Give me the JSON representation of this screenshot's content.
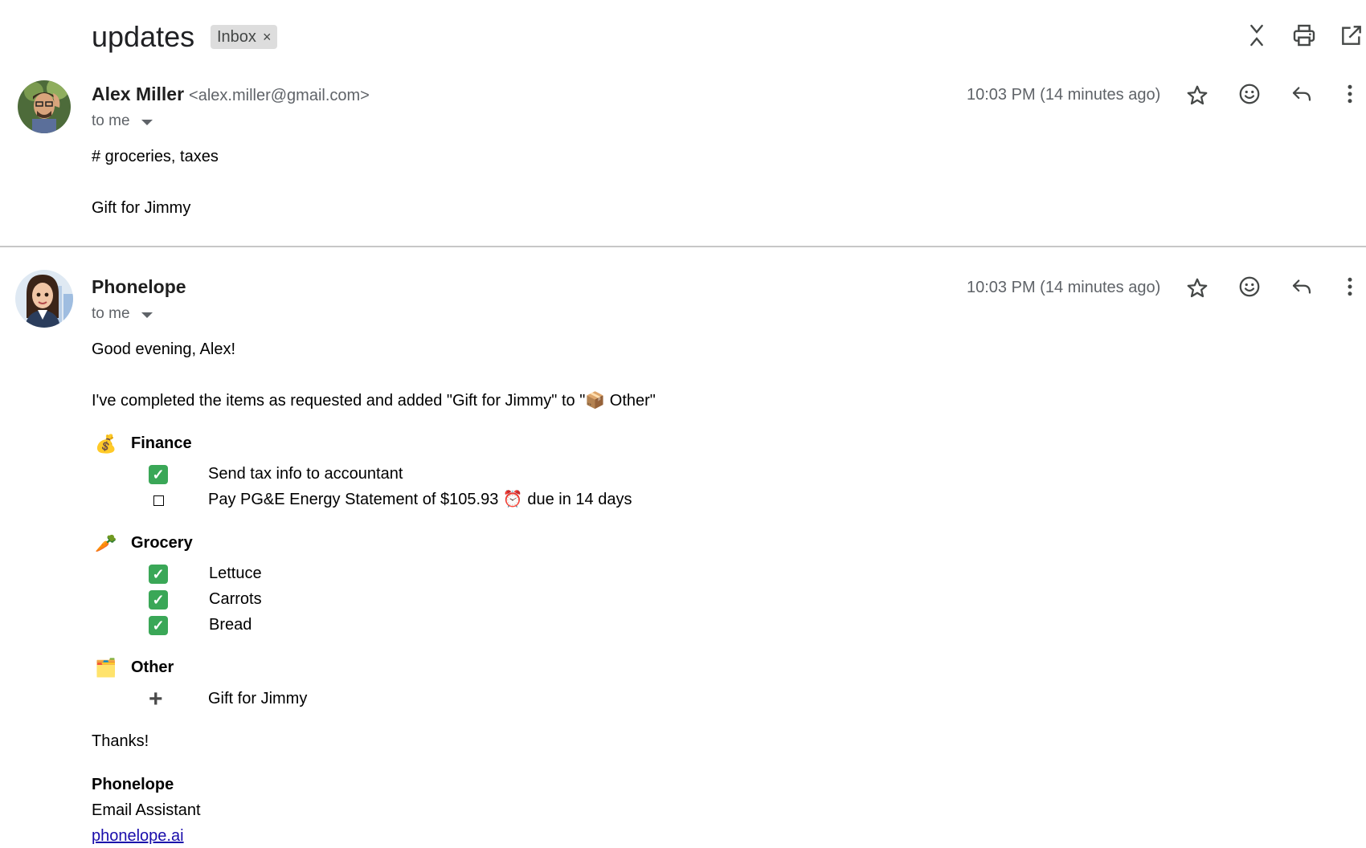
{
  "thread": {
    "subject": "updates",
    "label": "Inbox",
    "label_remove": "×",
    "header_icons": [
      "collapse-all-icon",
      "print-icon",
      "open-in-new-window-icon"
    ]
  },
  "messages": [
    {
      "sender_name": "Alex Miller",
      "sender_email": "<alex.miller@gmail.com>",
      "recipient": "to me",
      "time": "10:03 PM (14 minutes ago)",
      "body": {
        "line1": "# groceries, taxes",
        "line2": "Gift for Jimmy"
      }
    },
    {
      "sender_name": "Phonelope",
      "recipient": "to me",
      "time": "10:03 PM (14 minutes ago)",
      "body": {
        "greeting": "Good evening, Alex!",
        "intro_before": "I've completed the items as requested and added \"Gift for Jimmy\" to \"",
        "intro_emoji": "📦",
        "intro_after": " Other\"",
        "sections": [
          {
            "emoji": "💰",
            "title": "Finance",
            "items": [
              {
                "status": "done",
                "text": "Send tax info to accountant"
              },
              {
                "status": "open",
                "text_before": "Pay PG&E Energy Statement of $105.93 ",
                "emoji": "⏰",
                "text_after": " due in 14 days"
              }
            ]
          },
          {
            "emoji": "🥕",
            "title": "Grocery",
            "items": [
              {
                "status": "done",
                "text": "Lettuce"
              },
              {
                "status": "done",
                "text": "Carrots"
              },
              {
                "status": "done",
                "text": "Bread"
              }
            ]
          },
          {
            "emoji": "🗂️",
            "title": "Other",
            "items": [
              {
                "status": "added",
                "text": "Gift for Jimmy"
              }
            ]
          }
        ],
        "thanks": "Thanks!",
        "signature_name": "Phonelope",
        "signature_title": "Email Assistant",
        "signature_link": "phonelope.ai"
      }
    }
  ],
  "message_actions": [
    "star-icon",
    "emoji-reaction-icon",
    "reply-icon",
    "more-options-icon"
  ],
  "colors": {
    "check_green": "#3aa757",
    "link_blue": "#1a0dab",
    "meta_gray": "#5f6368"
  }
}
